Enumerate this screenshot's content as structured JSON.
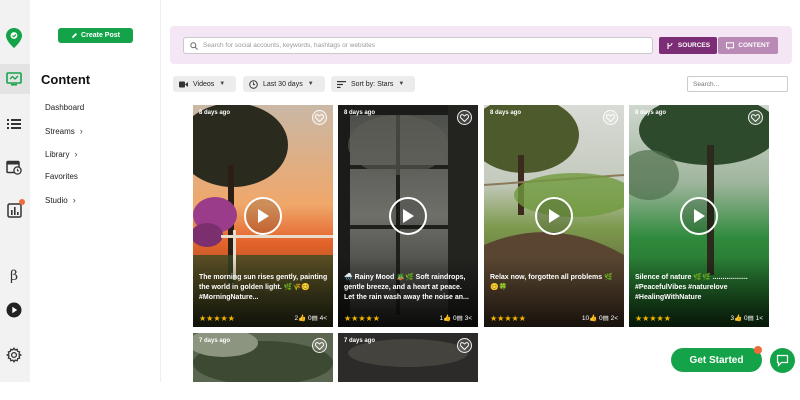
{
  "colors": {
    "brand_green": "#15a34a",
    "sources_purple": "#7b2d75",
    "content_mauve": "#b88ab5",
    "search_band": "#f4e6f4",
    "star": "#f5b700"
  },
  "rail": {
    "icons": [
      "location-pin-logo-icon",
      "content-icon",
      "list-icon",
      "calendar-icon",
      "analytics-icon",
      "beta-icon",
      "play-icon",
      "gear-icon"
    ],
    "beta_label": "β"
  },
  "subnav": {
    "create_post": "Create Post",
    "title": "Content",
    "items": [
      {
        "label": "Dashboard",
        "chevron": false
      },
      {
        "label": "Streams",
        "chevron": true
      },
      {
        "label": "Library",
        "chevron": true
      },
      {
        "label": "Favorites",
        "chevron": false
      },
      {
        "label": "Studio",
        "chevron": true
      }
    ]
  },
  "search": {
    "placeholder": "Search for social accounts, keywords, hashtags or websites",
    "sources_label": "SOURCES",
    "content_label": "CONTENT"
  },
  "filters": {
    "type": "Videos",
    "range": "Last 30 days",
    "sort": "Sort by: Stars",
    "search_placeholder": "Search..."
  },
  "cards": [
    {
      "age": "8 days ago",
      "caption": "The morning sun rises gently, painting the world in golden light. 🌿🌾😊 #MorningNature...",
      "stars": "★★★★★",
      "stats": "2👍 0▤ 4<"
    },
    {
      "age": "8 days ago",
      "caption": "🌧️ Rainy Mood 🪴🌿 Soft raindrops, gentle breeze, and a heart at peace. Let the rain wash away the noise an...",
      "stars": "★★★★★",
      "stats": "1👍 0▤ 3<"
    },
    {
      "age": "8 days ago",
      "caption": "Relax now, forgotten all problems 🌿 😊🍀",
      "stars": "★★★★★",
      "stats": "10👍 0▤ 2<"
    },
    {
      "age": "8 days ago",
      "caption": "Silence of nature 🌿🌿 .................. #PeacefulVibes #naturelove #HealingWithNature",
      "stars": "★★★★★",
      "stats": "3👍 0▤ 1<"
    },
    {
      "age": "7 days ago"
    },
    {
      "age": "7 days ago"
    }
  ],
  "floating": {
    "get_started": "Get Started"
  }
}
